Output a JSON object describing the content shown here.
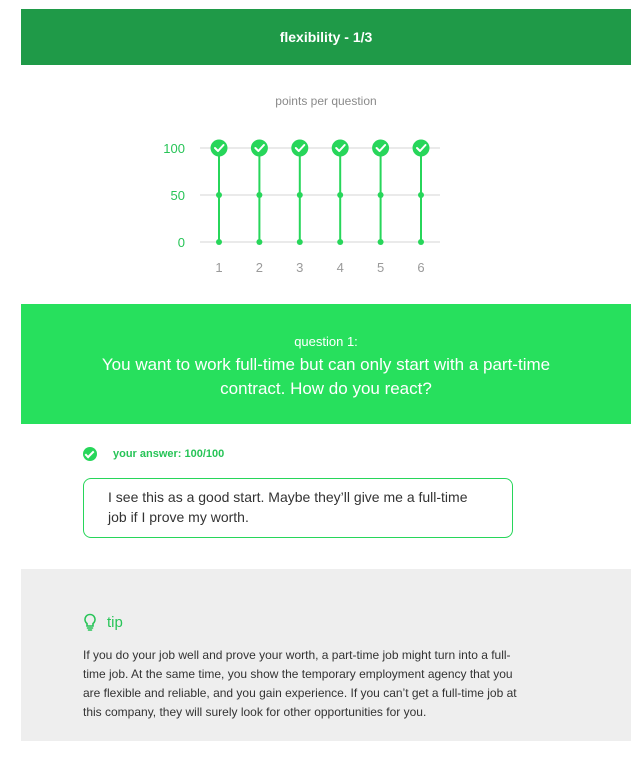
{
  "header": {
    "title": "flexibility - 1/3"
  },
  "chart": {
    "caption": "points per question"
  },
  "chart_data": {
    "type": "line",
    "title": "points per question",
    "categories": [
      "1",
      "2",
      "3",
      "4",
      "5",
      "6"
    ],
    "values": [
      100,
      100,
      100,
      100,
      100,
      100
    ],
    "yticks": [
      0,
      50,
      100
    ],
    "ylim": [
      0,
      100
    ],
    "color": "#27d65a",
    "tick_color": "#27c457",
    "grid": true
  },
  "question": {
    "number_label": "question 1:",
    "text": "You want to work full-time but can only start with a part-time contract. How do you react?"
  },
  "answer": {
    "label": "your answer: 100/100",
    "text": "I see this as a good start. Maybe they’ll give me a full-time job if I prove my worth."
  },
  "tip": {
    "title": "tip",
    "text": "If you do your job well and prove your worth, a part-time job might turn into a full-time job. At the same time, you show the temporary employment agency that you are flexible and reliable, and you gain experience. If you can’t get a full-time job at this company, they will surely look for other opportunities for you."
  },
  "icons": {
    "check": "check-circle-icon",
    "tip": "lightbulb-icon"
  },
  "colors": {
    "header": "#1f9a48",
    "accent": "#27e05d",
    "tip_bg": "#eeeeee"
  }
}
